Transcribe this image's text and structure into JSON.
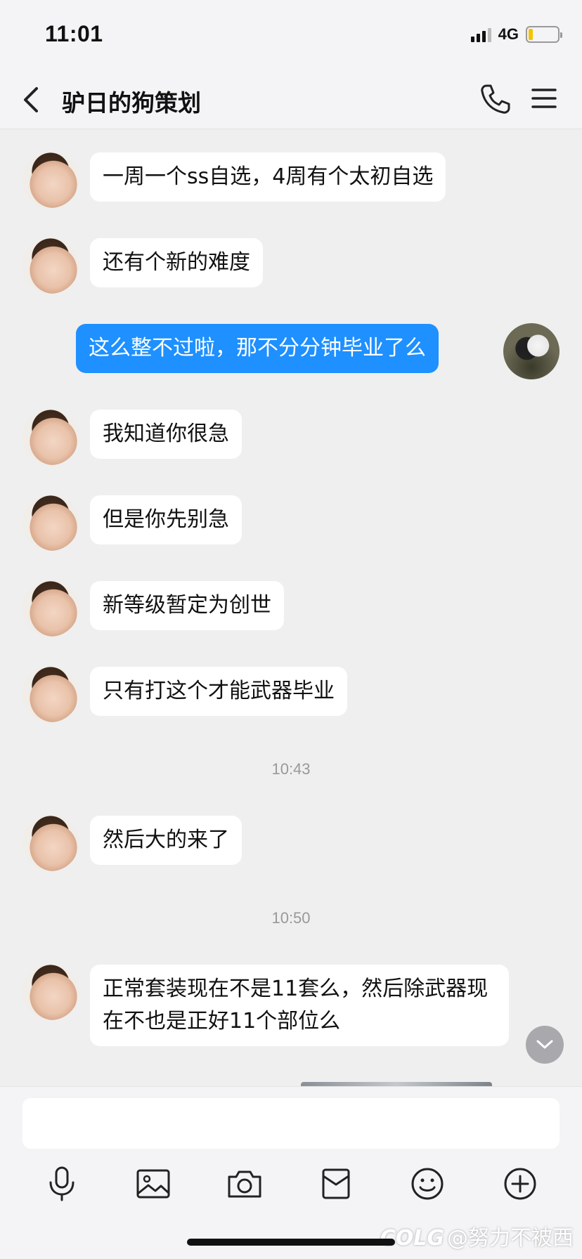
{
  "status_bar": {
    "time": "11:01",
    "network": "4G"
  },
  "header": {
    "title": "驴日的狗策划"
  },
  "messages": [
    {
      "side": "received",
      "text": "一周一个ss自选，4周有个太初自选"
    },
    {
      "side": "received",
      "text": "还有个新的难度"
    },
    {
      "side": "sent",
      "text": "这么整不过啦，那不分分钟毕业了么"
    },
    {
      "side": "received",
      "text": "我知道你很急"
    },
    {
      "side": "received",
      "text": "但是你先别急"
    },
    {
      "side": "received",
      "text": "新等级暂定为创世"
    },
    {
      "side": "received",
      "text": "只有打这个才能武器毕业"
    },
    {
      "side": "received",
      "text": "然后大的来了"
    },
    {
      "side": "received",
      "text": "正常套装现在不是11套么，然后除武器现在不也是正好11个部位么"
    }
  ],
  "timestamps": [
    "10:43",
    "10:50"
  ],
  "input": {
    "value": "",
    "placeholder": ""
  },
  "toolbar": [
    "microphone-icon",
    "image-icon",
    "camera-icon",
    "red-packet-icon",
    "emoji-icon",
    "plus-icon"
  ],
  "watermark": "@努力不被西",
  "watermark_logo": "COLG",
  "colors": {
    "sent_bubble": "#1e90ff",
    "received_bubble": "#ffffff",
    "background": "#efefef"
  }
}
